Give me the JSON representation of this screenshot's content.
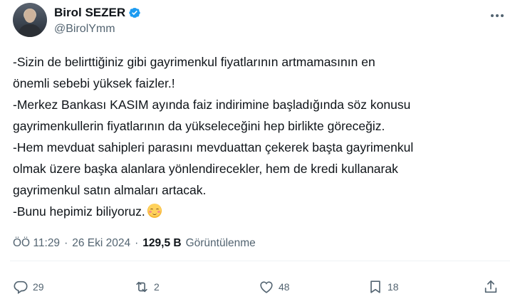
{
  "author": {
    "display_name": "Birol SEZER",
    "handle": "@BirolYmm",
    "verified": true
  },
  "tweet": {
    "lines": [
      "-Sizin de belirttiğiniz gibi gayrimenkul fiyatlarının artmamasının en",
      "önemli sebebi yüksek faizler.!",
      "-Merkez Bankası KASIM ayında faiz indirimine başladığında söz konusu",
      "gayrimenkullerin fiyatlarının da yükseleceğini hep birlikte göreceğiz.",
      "-Hem mevduat sahipleri parasını mevduattan çekerek başta gayrimenkul",
      "olmak üzere başka alanlara yönlendirecekler, hem de kredi kullanarak",
      "gayrimenkul satın almaları artacak.",
      "-Bunu hepimiz biliyoruz."
    ],
    "emoji": "smiling-face-with-smiling-eyes"
  },
  "meta": {
    "time": "ÖÖ 11:29",
    "separator": "·",
    "date": "26 Eki 2024",
    "separator2": "·",
    "views_count": "129,5 B",
    "views_label": "Görüntülenme"
  },
  "actions": {
    "replies": "29",
    "reposts": "2",
    "likes": "48",
    "bookmarks": "18"
  },
  "colors": {
    "text": "#0f1419",
    "secondary": "#536471",
    "verified": "#1d9bf0",
    "divider": "#eff3f4"
  }
}
